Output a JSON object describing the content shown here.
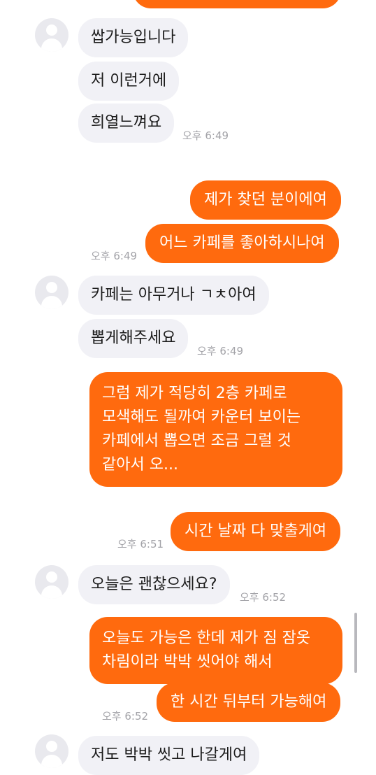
{
  "messages": [
    {
      "text": "쌉가능입니다"
    },
    {
      "text": "저 이런거에"
    },
    {
      "text": "희열느껴요"
    },
    {
      "text": "제가 찾던 분이에여"
    },
    {
      "text": "어느 카페를 좋아하시나여"
    },
    {
      "text": "카페는 아무거나 ㄱㅊ아여"
    },
    {
      "text": "뽑게해주세요"
    },
    {
      "text": "그럼 제가 적당히 2층 카페로 모색해도 될까여 카운터 보이는 카페에서 뽑으면 조금 그럴 것 같아서 오..."
    },
    {
      "text": "시간 날짜 다 맞출게여"
    },
    {
      "text": "오늘은 괜찮으세요?"
    },
    {
      "text": "오늘도 가능은 한데 제가 짐 잠옷 차림이라 박박 씻어야 해서"
    },
    {
      "text": "한 시간 뒤부터 가능해여"
    },
    {
      "text": "저도 박박 씻고 나갈게여"
    }
  ],
  "times": [
    "오후 6:49",
    "오후 6:49",
    "오후 6:49",
    "오후 6:51",
    "오후 6:52",
    "오후 6:52"
  ],
  "colors": {
    "outgoing_bubble": "#ff6a0e",
    "incoming_bubble": "#f1f1f6",
    "timestamp": "#a3a3a8"
  },
  "icons": {
    "avatar": "default-profile-avatar-icon"
  }
}
